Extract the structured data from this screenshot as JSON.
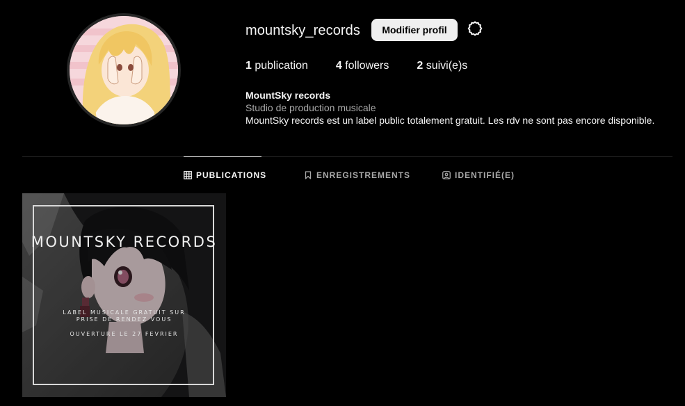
{
  "profile": {
    "username": "mountsky_records",
    "edit_profile_label": "Modifier profil",
    "settings_icon": "gear-icon",
    "stats": [
      {
        "count": "1",
        "label": "publication"
      },
      {
        "count": "4",
        "label": "followers"
      },
      {
        "count": "2",
        "label": "suivi(e)s"
      }
    ],
    "bio": {
      "name": "MountSky records",
      "category": "Studio de production musicale",
      "text": "MountSky records est un label public totalement gratuit. Les rdv ne sont pas encore disponible."
    }
  },
  "tabs": [
    {
      "label": "PUBLICATIONS",
      "icon": "grid-icon",
      "active": true
    },
    {
      "label": "ENREGISTREMENTS",
      "icon": "bookmark-icon",
      "active": false
    },
    {
      "label": "IDENTIFIÉ(E)",
      "icon": "tagged-icon",
      "active": false
    }
  ],
  "posts": [
    {
      "title": "MOUNTSKY RECORDS",
      "line1": "LABEL MUSICALE GRATUIT SUR",
      "line2": "PRISE DE RENDEZ VOUS",
      "line3": "OUVERTURE LE 27 FEVRIER"
    }
  ],
  "colors": {
    "background": "#000000",
    "text": "#f5f5f5",
    "secondary_text": "#a8a8a8",
    "button_bg": "#efefef",
    "divider": "#262626"
  }
}
